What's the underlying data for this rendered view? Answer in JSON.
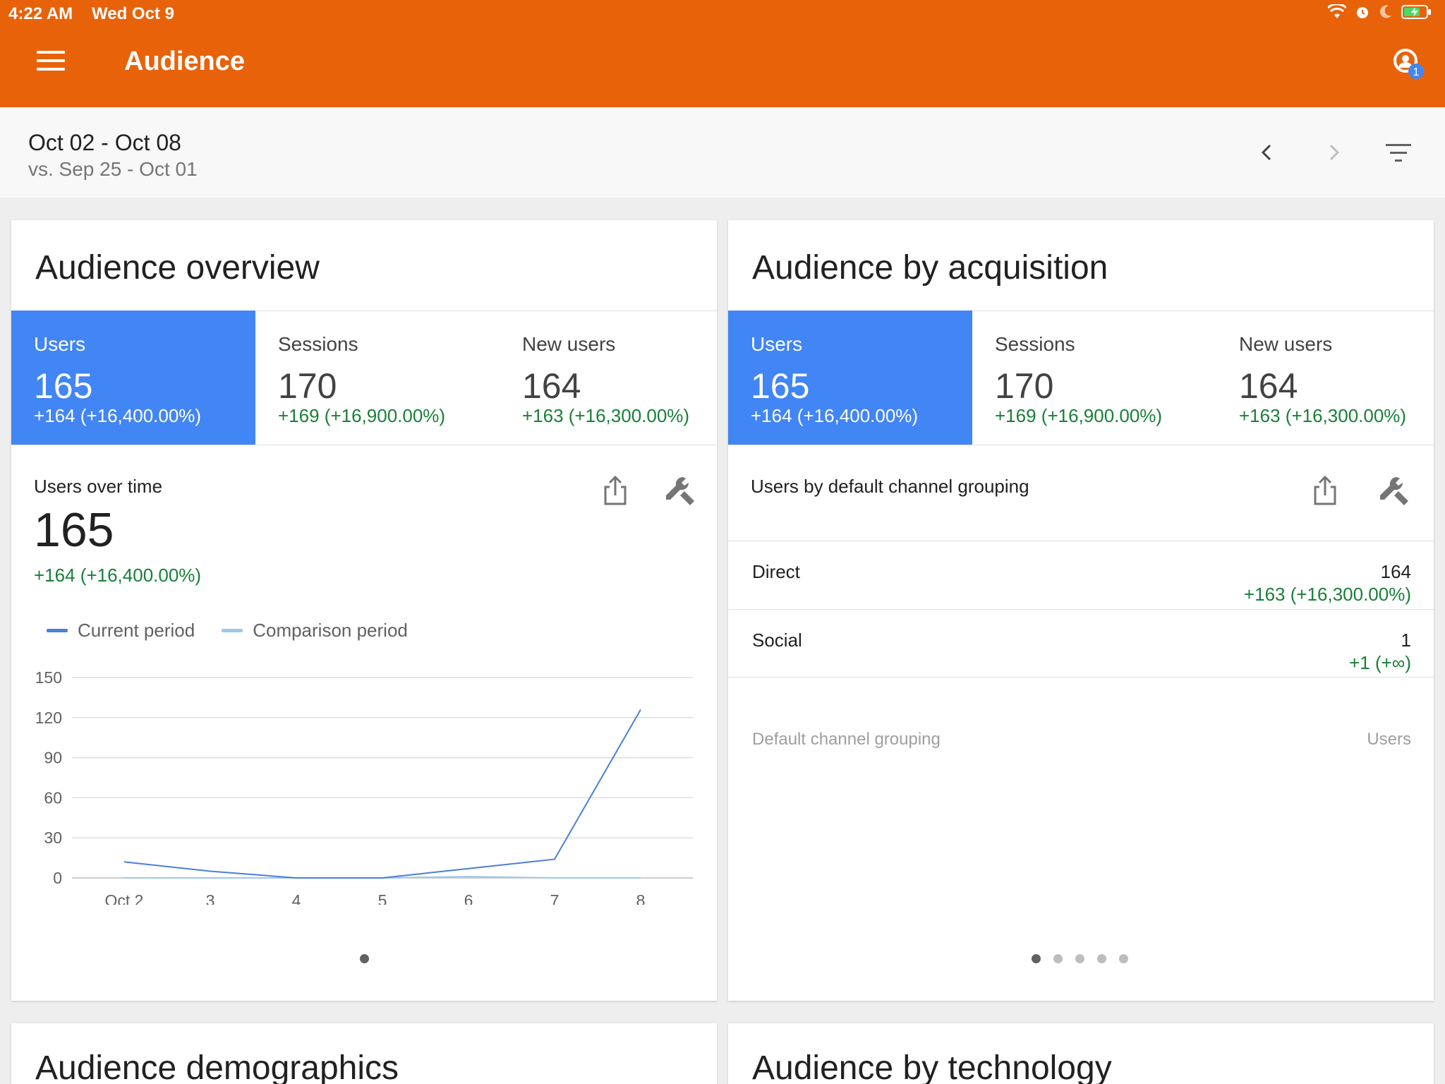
{
  "status_bar": {
    "time": "4:22 AM",
    "date": "Wed Oct 9"
  },
  "app_bar": {
    "title": "Audience",
    "notification_count": "1",
    "background_color": "#e8620a"
  },
  "date_bar": {
    "range": "Oct 02 - Oct 08",
    "comparison": "vs. Sep 25 - Oct 01"
  },
  "overview_card": {
    "title": "Audience overview",
    "metrics": [
      {
        "label": "Users",
        "value": "165",
        "change": "+164 (+16,400.00%)"
      },
      {
        "label": "Sessions",
        "value": "170",
        "change": "+169 (+16,900.00%)"
      },
      {
        "label": "New users",
        "value": "164",
        "change": "+163 (+16,300.00%)"
      }
    ],
    "section_title": "Users over time",
    "big_value": "165",
    "big_change": "+164 (+16,400.00%)",
    "legend": [
      {
        "label": "Current period",
        "color": "#4a7fd9"
      },
      {
        "label": "Comparison period",
        "color": "#9fc7ea"
      }
    ]
  },
  "chart_data": {
    "type": "line",
    "x": [
      "Oct 2",
      "3",
      "4",
      "5",
      "6",
      "7",
      "8"
    ],
    "ylim": [
      0,
      150
    ],
    "yticks": [
      "150",
      "120",
      "90",
      "60",
      "30",
      "0"
    ],
    "grid": true,
    "legend_position": "top-left",
    "series": [
      {
        "name": "Current period",
        "color": "#4a7fd9",
        "values": [
          12,
          5,
          0,
          0,
          7,
          14,
          126
        ]
      },
      {
        "name": "Comparison period",
        "color": "#9fc7ea",
        "values": [
          0,
          0,
          0,
          0,
          1,
          0,
          0
        ]
      }
    ]
  },
  "acquisition_card": {
    "title": "Audience by acquisition",
    "metrics": [
      {
        "label": "Users",
        "value": "165",
        "change": "+164 (+16,400.00%)"
      },
      {
        "label": "Sessions",
        "value": "170",
        "change": "+169 (+16,900.00%)"
      },
      {
        "label": "New users",
        "value": "164",
        "change": "+163 (+16,300.00%)"
      }
    ],
    "section_title": "Users by default channel grouping",
    "column_left": "Default channel grouping",
    "column_right": "Users",
    "rows": [
      {
        "label": "Direct",
        "value": "164",
        "change": "+163 (+16,300.00%)"
      },
      {
        "label": "Social",
        "value": "1",
        "change": "+1 (+∞)"
      }
    ]
  },
  "bottom_cards": {
    "left_title": "Audience demographics",
    "right_title": "Audience by technology"
  }
}
